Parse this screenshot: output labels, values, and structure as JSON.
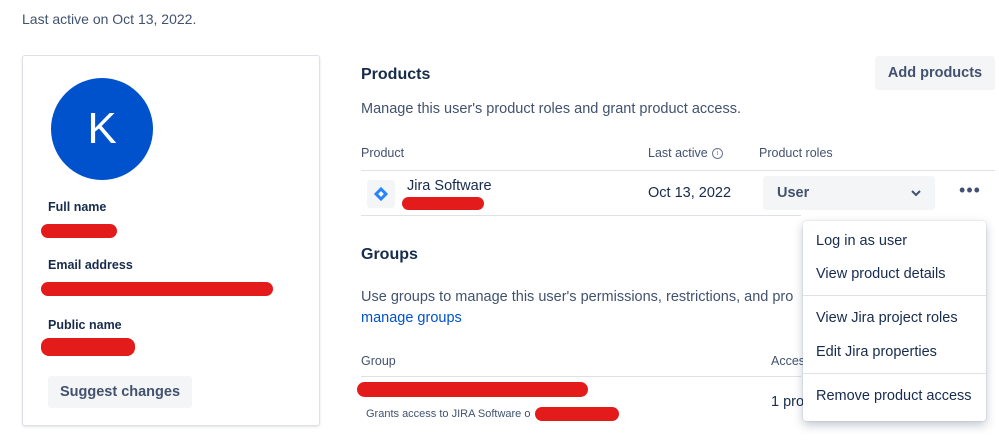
{
  "status": {
    "last_active": "Last active on Oct 13, 2022."
  },
  "profile": {
    "avatar_letter": "K",
    "full_name_label": "Full name",
    "email_label": "Email address",
    "public_name_label": "Public name",
    "suggest_button": "Suggest changes"
  },
  "products": {
    "title": "Products",
    "add_button": "Add products",
    "description": "Manage this user's product roles and grant product access.",
    "columns": {
      "product": "Product",
      "last_active": "Last active",
      "roles": "Product roles"
    },
    "rows": [
      {
        "name": "Jira Software",
        "last_active": "Oct 13, 2022",
        "role": "User"
      }
    ]
  },
  "groups": {
    "title": "Groups",
    "description": "Use groups to manage this user's permissions, restrictions, and pro",
    "manage_link": "manage groups",
    "columns": {
      "group": "Group",
      "access": "Acces"
    },
    "rows": [
      {
        "grants": "Grants access to JIRA Software o",
        "access": "1 pro"
      }
    ]
  },
  "menu": {
    "items": [
      "Log in as user",
      "View product details",
      "View Jira project roles",
      "Edit Jira properties",
      "Remove product access"
    ]
  },
  "colors": {
    "accent": "#0052cc",
    "redaction": "#e31b1b",
    "text": "#172b4d",
    "subtle": "#42526e"
  }
}
